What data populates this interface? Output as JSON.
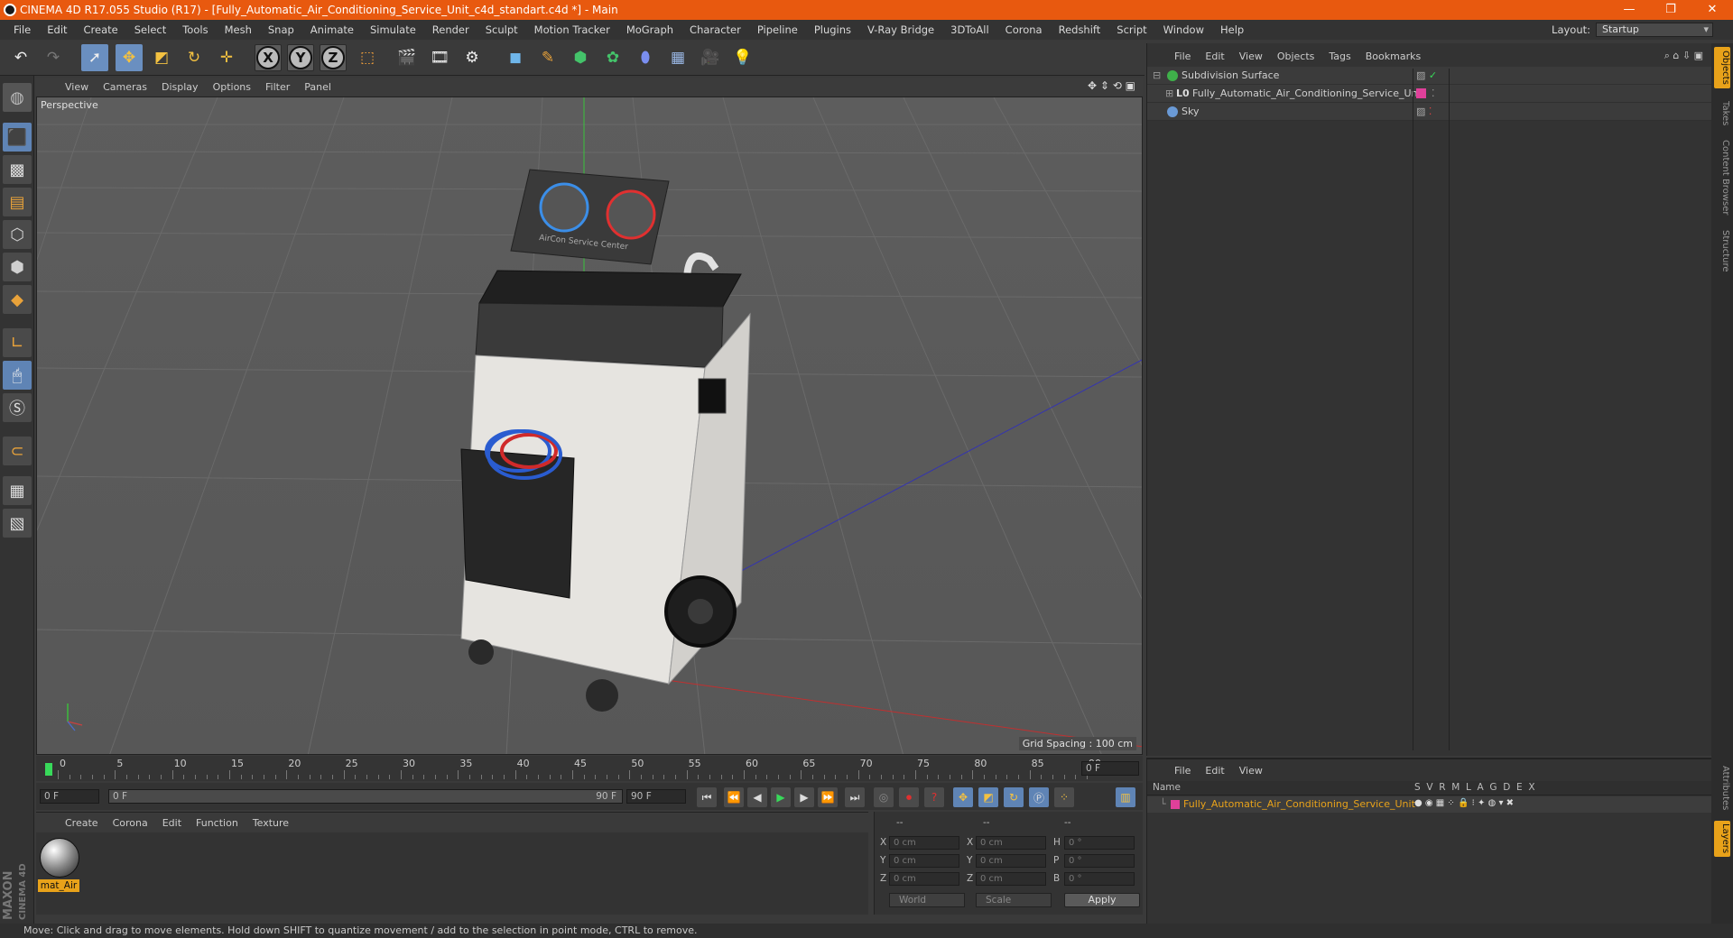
{
  "window": {
    "title": "CINEMA 4D R17.055 Studio (R17) - [Fully_Automatic_Air_Conditioning_Service_Unit_c4d_standart.c4d *] - Main",
    "minimize": "—",
    "maximize": "❐",
    "close": "✕"
  },
  "menu": [
    "File",
    "Edit",
    "Create",
    "Select",
    "Tools",
    "Mesh",
    "Snap",
    "Animate",
    "Simulate",
    "Render",
    "Sculpt",
    "Motion Tracker",
    "MoGraph",
    "Character",
    "Pipeline",
    "Plugins",
    "V-Ray Bridge",
    "3DToAll",
    "Corona",
    "Redshift",
    "Script",
    "Window",
    "Help"
  ],
  "layout": {
    "label": "Layout:",
    "value": "Startup"
  },
  "viewport": {
    "menu": [
      "View",
      "Cameras",
      "Display",
      "Options",
      "Filter",
      "Panel"
    ],
    "label": "Perspective",
    "grid_spacing": "Grid Spacing : 100 cm",
    "model_label": "AirCon Service Center"
  },
  "timeline": {
    "ticks": [
      "0",
      "5",
      "10",
      "15",
      "20",
      "25",
      "30",
      "35",
      "40",
      "45",
      "50",
      "55",
      "60",
      "65",
      "70",
      "75",
      "80",
      "85",
      "90"
    ],
    "current_frame": "0 F",
    "start_field": "0 F",
    "range_start": "0 F",
    "range_end": "90 F",
    "end_field": "90 F"
  },
  "material_panel": {
    "menu": [
      "Create",
      "Corona",
      "Edit",
      "Function",
      "Texture"
    ],
    "material_name": "mat_Air"
  },
  "coords": {
    "headers": [
      "--",
      "--",
      "--"
    ],
    "rows": [
      {
        "l1": "X",
        "v1": "0 cm",
        "l2": "X",
        "v2": "0 cm",
        "l3": "H",
        "v3": "0 °"
      },
      {
        "l1": "Y",
        "v1": "0 cm",
        "l2": "Y",
        "v2": "0 cm",
        "l3": "P",
        "v3": "0 °"
      },
      {
        "l1": "Z",
        "v1": "0 cm",
        "l2": "Z",
        "v2": "0 cm",
        "l3": "B",
        "v3": "0 °"
      }
    ],
    "space": "World",
    "mode": "Scale",
    "apply": "Apply"
  },
  "objects_panel": {
    "menu": [
      "File",
      "Edit",
      "View",
      "Objects",
      "Tags",
      "Bookmarks"
    ],
    "items": [
      {
        "name": "Subdivision Surface",
        "color": "#3fb04a"
      },
      {
        "name": "Fully_Automatic_Air_Conditioning_Service_Unit",
        "color": "#d6d6d6"
      },
      {
        "name": "Sky",
        "color": "#6a9ad6"
      }
    ]
  },
  "layers_panel": {
    "menu": [
      "File",
      "Edit",
      "View"
    ],
    "header_name": "Name",
    "columns": [
      "S",
      "V",
      "R",
      "M",
      "L",
      "A",
      "G",
      "D",
      "E",
      "X"
    ],
    "layer_name": "Fully_Automatic_Air_Conditioning_Service_Unit",
    "layer_color": "#e0409a"
  },
  "right_tabs": [
    "Objects",
    "Takes",
    "Content Browser",
    "Structure"
  ],
  "right_tabs_lower": [
    "Attributes",
    "Layers"
  ],
  "logo": {
    "maxon": "MAXON",
    "cinema": "CINEMA 4D"
  },
  "status": "Move: Click and drag to move elements. Hold down SHIFT to quantize movement / add to the selection in point mode, CTRL to remove."
}
